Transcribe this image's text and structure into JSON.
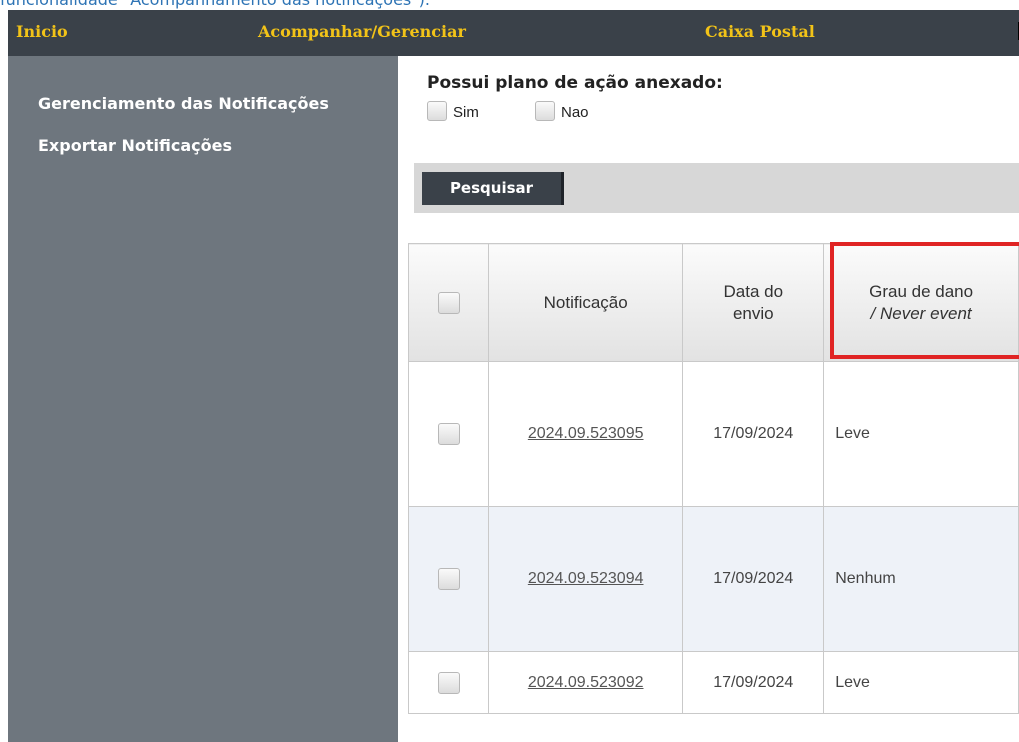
{
  "caption": "funcionalidade \"Acompanhamento das notificações\").",
  "nav": {
    "items": [
      "Inicio",
      "Acompanhar/Gerenciar",
      "Caixa Postal"
    ]
  },
  "sidebar": {
    "items": [
      "Gerenciamento das Notificações",
      "Exportar Notificações"
    ]
  },
  "filter": {
    "label": "Possui plano de ação anexado:",
    "options": [
      "Sim",
      "Nao"
    ]
  },
  "search": {
    "button_label": "Pesquisar"
  },
  "table": {
    "headers": {
      "notificacao": "Notificação",
      "data_line1": "Data do",
      "data_line2": "envio",
      "grau_line1": "Grau de dano",
      "grau_line2": "/ Never event"
    },
    "rows": [
      {
        "id": "2024.09.523095",
        "date": "17/09/2024",
        "grau": "Leve"
      },
      {
        "id": "2024.09.523094",
        "date": "17/09/2024",
        "grau": "Nenhum"
      },
      {
        "id": "2024.09.523092",
        "date": "17/09/2024",
        "grau": "Leve"
      }
    ]
  },
  "colors": {
    "nav_bg": "#3a4149",
    "nav_text": "#f2c318",
    "sidebar_bg": "#6e767e",
    "highlight": "#e02424"
  }
}
